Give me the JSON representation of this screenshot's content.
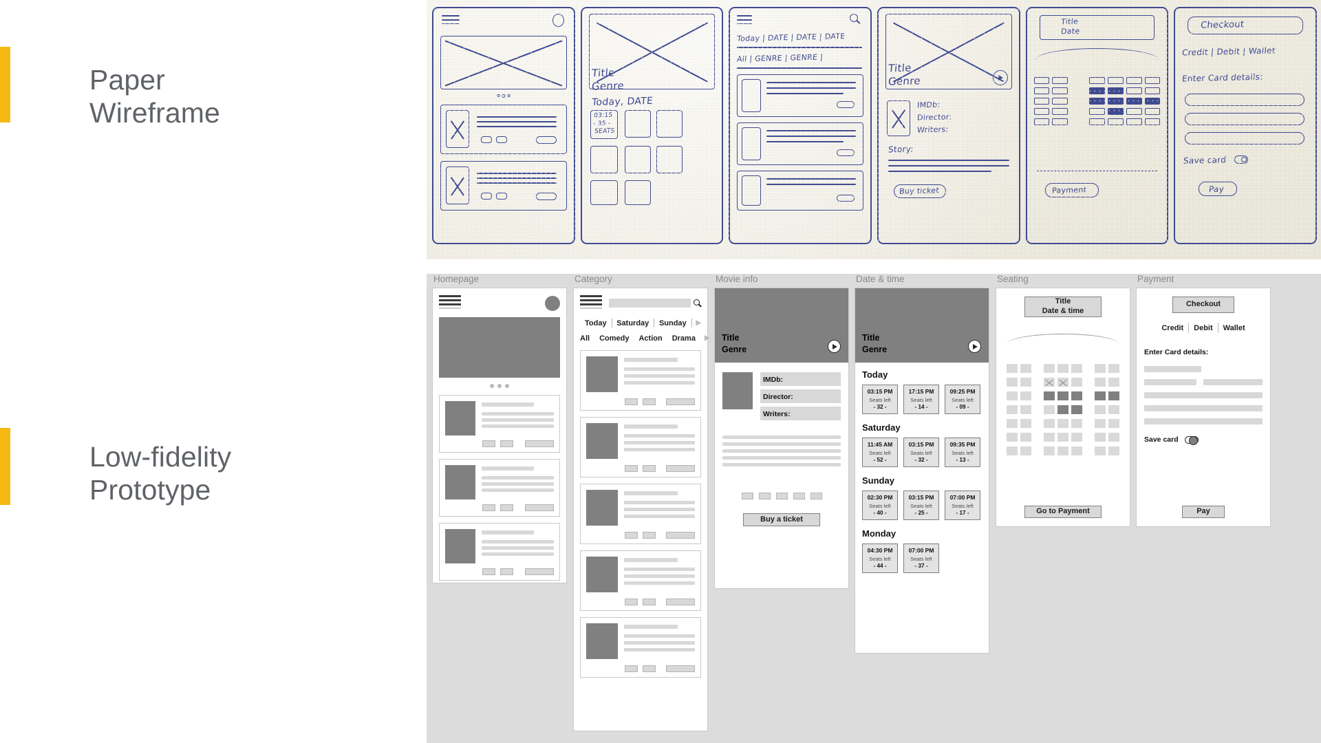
{
  "sections": {
    "paper": {
      "line1": "Paper",
      "line2": "Wireframe",
      "accent_color": "#f5b912"
    },
    "prototype": {
      "line1": "Low-fidelity",
      "line2": "Prototype",
      "accent_color": "#f5b912"
    }
  },
  "paper_wireframe": {
    "alt": "hand-drawn blue-ink paper wireframe of six mobile screens",
    "frames": [
      {
        "name": "homepage",
        "texts": []
      },
      {
        "name": "category",
        "texts": [
          "Title",
          "Genre",
          "Today, DATE",
          "03:15",
          "- 35 -",
          "SEATS"
        ]
      },
      {
        "name": "movie-list",
        "texts": [
          "Today | DATE | DATE | DATE",
          "All | GENRE | GENRE |"
        ]
      },
      {
        "name": "movie-info",
        "texts": [
          "Title",
          "Genre",
          "IMDb:",
          "Director:",
          "Writers:",
          "Story:",
          "Buy ticket"
        ]
      },
      {
        "name": "seating",
        "texts": [
          "Title",
          "Date",
          "Payment"
        ]
      },
      {
        "name": "payment",
        "texts": [
          "Checkout",
          "Credit | Debit | Wallet",
          "Enter Card details:",
          "Save card",
          "Pay"
        ]
      }
    ]
  },
  "prototype": {
    "screens": {
      "homepage": {
        "label": "Homepage",
        "icons": {
          "menu": "hamburger-icon",
          "avatar": "avatar-icon"
        },
        "carousel_dots": 3,
        "cards": 3
      },
      "category": {
        "label": "Category",
        "icons": {
          "menu": "hamburger-icon",
          "search": "search-icon"
        },
        "search_placeholder": "",
        "day_tabs": [
          "Today",
          "Saturday",
          "Sunday"
        ],
        "genre_tabs": [
          "All",
          "Comedy",
          "Action",
          "Drama"
        ],
        "more_arrow": "▶",
        "cards": 5
      },
      "movie_info": {
        "label": "Movie info",
        "hero_title": "Title",
        "hero_subtitle": "Genre",
        "play_icon": "play-icon",
        "meta": [
          "IMDb:",
          "Director:",
          "Writers:"
        ],
        "thumb_count": 5,
        "cta": "Buy a ticket"
      },
      "date_time": {
        "label": "Date & time",
        "hero_title": "Title",
        "hero_subtitle": "Genre",
        "play_icon": "play-icon",
        "days": [
          {
            "name": "Today",
            "shows": [
              {
                "time": "03:15 PM",
                "sub": "Seats left",
                "seats": "- 32 -"
              },
              {
                "time": "17:15 PM",
                "sub": "Seats left",
                "seats": "- 14 -"
              },
              {
                "time": "09:25 PM",
                "sub": "Seats left",
                "seats": "- 09 -"
              }
            ]
          },
          {
            "name": "Saturday",
            "shows": [
              {
                "time": "11:45 AM",
                "sub": "Seats left",
                "seats": "- 52 -"
              },
              {
                "time": "03:15 PM",
                "sub": "Seats left",
                "seats": "- 32 -"
              },
              {
                "time": "09:35 PM",
                "sub": "Seats left",
                "seats": "- 13 -"
              }
            ]
          },
          {
            "name": "Sunday",
            "shows": [
              {
                "time": "02:30 PM",
                "sub": "Seats left",
                "seats": "- 40 -"
              },
              {
                "time": "03:15 PM",
                "sub": "Seats left",
                "seats": "- 25 -"
              },
              {
                "time": "07:00 PM",
                "sub": "Seats left",
                "seats": "- 17 -"
              }
            ]
          },
          {
            "name": "Monday",
            "shows": [
              {
                "time": "04:30 PM",
                "sub": "Seats left",
                "seats": "- 44 -"
              },
              {
                "time": "07:00 PM",
                "sub": "Seats left",
                "seats": "- 37 -"
              }
            ]
          }
        ]
      },
      "seating": {
        "label": "Seating",
        "header_line1": "Title",
        "header_line2": "Date & time",
        "screen_curve": true,
        "rows": 7,
        "cols": 7,
        "seat_map": [
          [
            "free",
            "free",
            "free",
            "free",
            "free",
            "free",
            "free"
          ],
          [
            "free",
            "free",
            "blocked",
            "blocked",
            "free",
            "free",
            "free"
          ],
          [
            "free",
            "free",
            "taken",
            "taken",
            "taken",
            "taken",
            "taken"
          ],
          [
            "free",
            "free",
            "free",
            "taken",
            "taken",
            "free",
            "free"
          ],
          [
            "free",
            "free",
            "free",
            "free",
            "free",
            "free",
            "free"
          ],
          [
            "free",
            "free",
            "free",
            "free",
            "free",
            "free",
            "free"
          ],
          [
            "free",
            "free",
            "free",
            "free",
            "free",
            "free",
            "free"
          ]
        ],
        "cta": "Go to Payment"
      },
      "payment": {
        "label": "Payment",
        "header": "Checkout",
        "methods": [
          "Credit",
          "Debit",
          "Wallet"
        ],
        "form_label": "Enter Card details:",
        "save_card_label": "Save card",
        "save_card_on": false,
        "cta": "Pay"
      }
    }
  },
  "colors": {
    "accent": "#f5b912",
    "panel_bg": "#dcdcdc",
    "label_text": "#5f6368",
    "placeholder_gray": "#d8d8d8",
    "image_gray": "#808080",
    "ink_blue": "#3e4a91",
    "paper_bg": "#f3f1e9"
  }
}
